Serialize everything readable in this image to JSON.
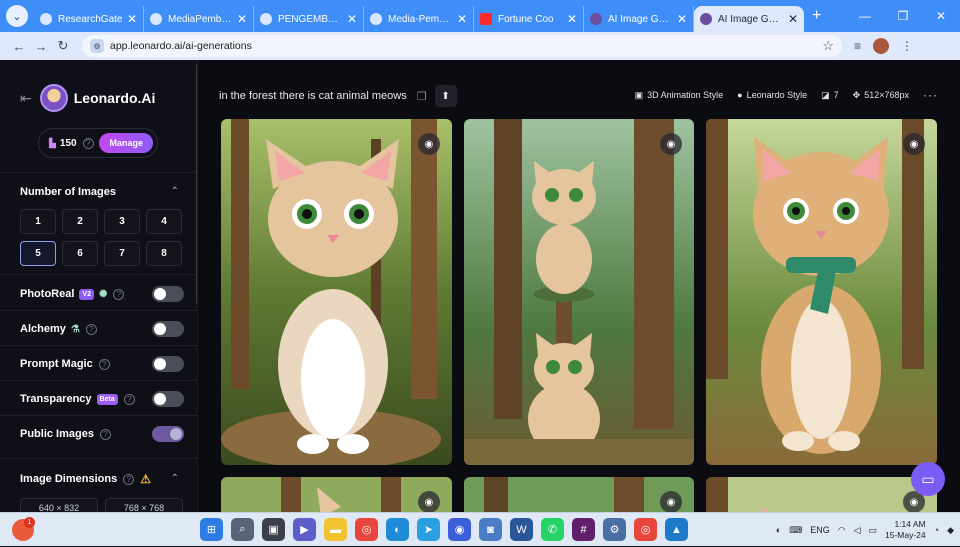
{
  "browser": {
    "tabs": [
      {
        "label": "ResearchGate",
        "favicon": "researchgate-icon",
        "active": false
      },
      {
        "label": "MediaPembelaj",
        "favicon": "globe-icon",
        "active": false
      },
      {
        "label": "PENGEMBANGA",
        "favicon": "globe-icon",
        "active": false
      },
      {
        "label": "Media-Pembela",
        "favicon": "globe-icon",
        "active": false
      },
      {
        "label": "Fortune Coo",
        "favicon": "youtube-icon",
        "active": false
      },
      {
        "label": "AI Image Genera",
        "favicon": "leonardo-icon",
        "active": false
      },
      {
        "label": "AI Image Genera",
        "favicon": "leonardo-icon",
        "active": true
      }
    ],
    "new_tab": "+",
    "url": "app.leonardo.ai/ai-generations"
  },
  "sidebar": {
    "brand": "Leonardo.Ai",
    "tokens": "150",
    "manage_label": "Manage",
    "number_of_images": {
      "title": "Number of Images",
      "options": [
        "1",
        "2",
        "3",
        "4",
        "5",
        "6",
        "7",
        "8"
      ],
      "selected": "5"
    },
    "photoreal": {
      "label": "PhotoReal",
      "badge": "V2",
      "on": false
    },
    "alchemy": {
      "label": "Alchemy",
      "on": false
    },
    "prompt_magic": {
      "label": "Prompt Magic",
      "on": false
    },
    "transparency": {
      "label": "Transparency",
      "badge": "Beta",
      "on": false
    },
    "public_images": {
      "label": "Public Images",
      "on": true
    },
    "image_dimensions": {
      "title": "Image Dimensions",
      "options": [
        "640 × 832",
        "768 × 768"
      ]
    }
  },
  "main": {
    "prompt": "in the forest there is cat animal meows",
    "meta": {
      "style": "3D Animation Style",
      "model": "Leonardo Style",
      "count": "7",
      "size": "512×768px",
      "more": "···"
    }
  },
  "taskbar": {
    "language": "ENG",
    "time": "1:14 AM",
    "date": "15-May-24"
  },
  "colors": {
    "accent": "#8f5cf6",
    "tab_strip": "#3f8ef7",
    "background": "#0b0b12"
  }
}
